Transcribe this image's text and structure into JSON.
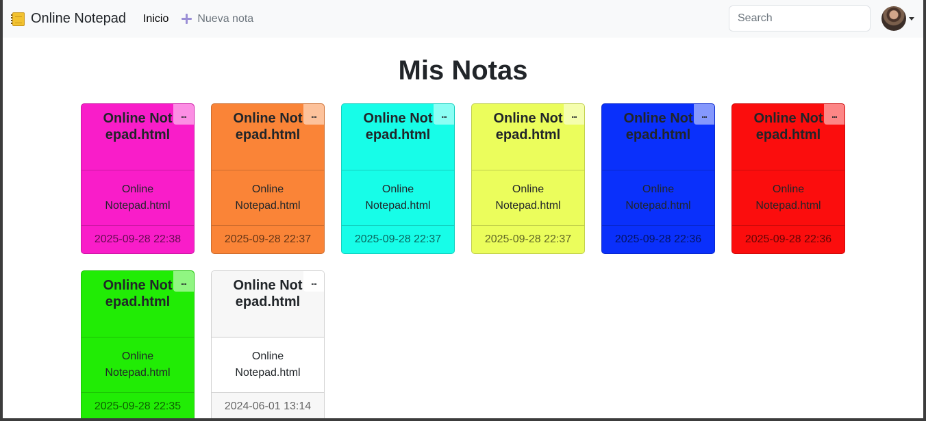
{
  "navbar": {
    "brand": "Online Notepad",
    "home": "Inicio",
    "new_note": "Nueva nota",
    "search_placeholder": "Search"
  },
  "page_title": "Mis Notas",
  "notes": [
    {
      "title": "Online Notepad.html",
      "body": "Online Notepad.html",
      "date": "2025-09-28 22:38",
      "color": "#f91dc9",
      "menu": "..."
    },
    {
      "title": "Online Notepad.html",
      "body": "Online Notepad.html",
      "date": "2025-09-28 22:37",
      "color": "#fa8437",
      "menu": "..."
    },
    {
      "title": "Online Notepad.html",
      "body": "Online Notepad.html",
      "date": "2025-09-28 22:37",
      "color": "#17fde8",
      "menu": "..."
    },
    {
      "title": "Online Notepad.html",
      "body": "Online Notepad.html",
      "date": "2025-09-28 22:37",
      "color": "#ebfd5c",
      "menu": "..."
    },
    {
      "title": "Online Notepad.html",
      "body": "Online Notepad.html",
      "date": "2025-09-28 22:36",
      "color": "#0a30fb",
      "menu": "..."
    },
    {
      "title": "Online Notepad.html",
      "body": "Online Notepad.html",
      "date": "2025-09-28 22:36",
      "color": "#fb0d0d",
      "menu": "..."
    },
    {
      "title": "Online Notepad.html",
      "body": "Online Notepad.html",
      "date": "2025-09-28 22:35",
      "color": "#21ec05",
      "menu": "..."
    },
    {
      "title": "Online Notepad.html",
      "body": "Online Notepad.html",
      "date": "2024-06-01 13:14",
      "color": "#ffffff",
      "menu": "..."
    }
  ]
}
